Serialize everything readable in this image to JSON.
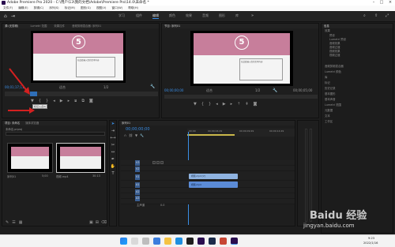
{
  "window": {
    "title": "Adobe Premiere Pro 2020 - C:\\用户\\13\\我的文档\\Adobe\\Premiere Pro\\14.0\\未命名 *"
  },
  "menu": {
    "items": [
      "文件(F)",
      "编辑(E)",
      "剪辑(C)",
      "序列(S)",
      "标记(M)",
      "图形(G)",
      "视图(V)",
      "窗口(W)",
      "帮助(H)"
    ]
  },
  "workspaces": {
    "items": [
      "学习",
      "组件",
      "编辑",
      "颜色",
      "效果",
      "音频",
      "图形",
      "库"
    ],
    "active": 2
  },
  "source_panel": {
    "label": "源:(无剪辑)",
    "tabs": [
      "Lumetri 范围",
      "效果控件",
      "音频剪辑混合器: 序列01"
    ],
    "timecode": "00;01;17;11",
    "in_tc": "00;00;00;00",
    "fit": "适合",
    "fraction": "1/2",
    "tooltip": "标记入点(I)"
  },
  "program_panel": {
    "label": "节目: 序列01",
    "timecode": "00;00;00;00",
    "fit": "适合",
    "fraction": "1/2",
    "duration": "00;00;05;00"
  },
  "slide": {
    "number": "5",
    "body_text": "在此处输入您的文本内容"
  },
  "project_panel": {
    "tabs": [
      "项目: 未命名",
      "媒体浏览器"
    ],
    "file": "未命名.prproj",
    "media": [
      {
        "name": "序列01",
        "duration": "5;00"
      },
      {
        "name": "视频.mp4",
        "duration": "30:13"
      }
    ]
  },
  "timeline": {
    "tab": "序列01",
    "timecode": "00;00;00;00",
    "ruler": [
      "00;00",
      "00;00;04;29",
      "00;00;09;29",
      "00;00;14;29"
    ],
    "video_tracks": [
      "V3",
      "V2",
      "V1"
    ],
    "audio_tracks": [
      "A1",
      "A2",
      "A3"
    ],
    "master_label": "主声道",
    "master_value": "0.0",
    "clips": {
      "video": "视频.mp4 [V]",
      "audio": "视频.mp4"
    }
  },
  "right_panel": {
    "sections": [
      "信息",
      "效果",
      "音频剪辑混合器",
      "Lumetri 颜色",
      "库",
      "标记",
      "历史记录",
      "基本图形",
      "基本声音",
      "Lumetri 范围",
      "元数据",
      "文本",
      "工作区"
    ],
    "effects_tree": [
      "预设",
      "Lumetri 预设",
      "音频效果",
      "音频过渡",
      "视频效果",
      "视频过渡"
    ]
  },
  "taskbar": {
    "time": "9:23",
    "date": "2022/1/16"
  },
  "watermark": {
    "brand": "Baidu 经验",
    "url": "jingyan.baidu.com"
  },
  "colors": {
    "accent_blue": "#3a8ee6",
    "clip_video": "#8fb3e0",
    "clip_audio": "#5b8bd6",
    "annotation_red": "#d42020",
    "slide_pink": "#c77e9b"
  }
}
